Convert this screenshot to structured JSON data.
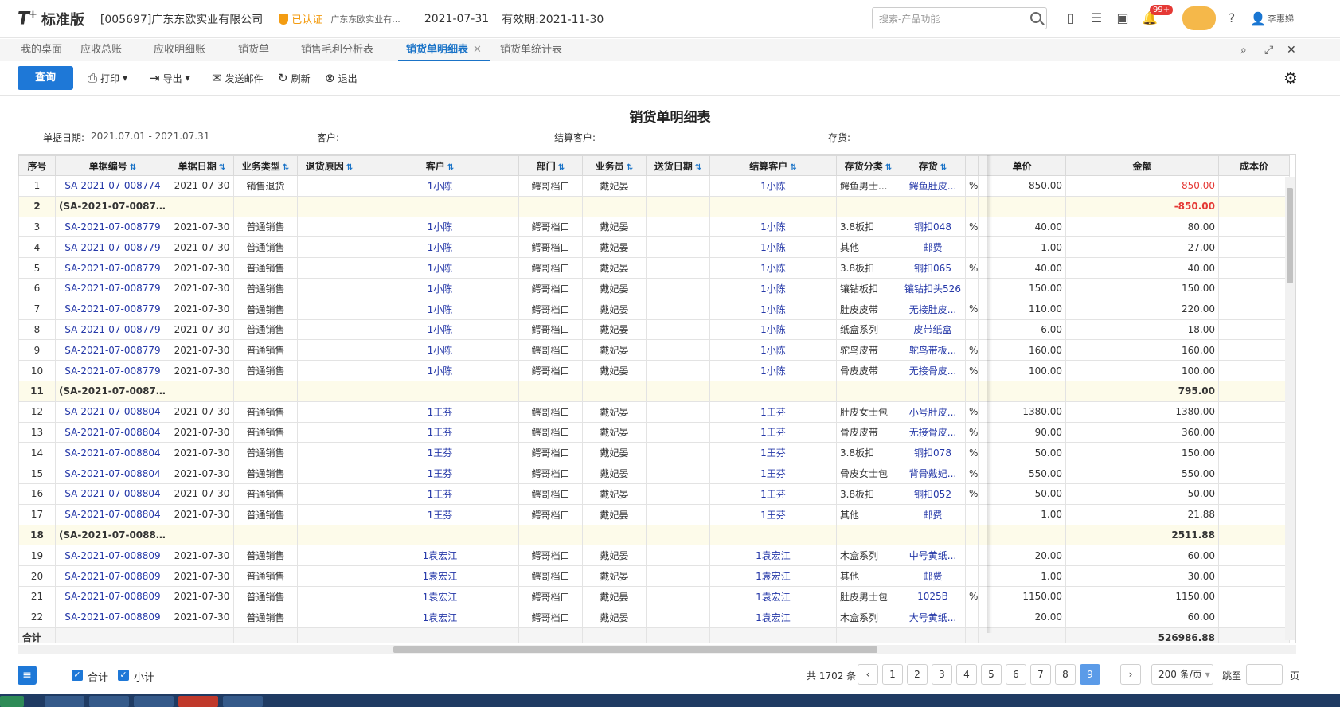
{
  "header": {
    "logo": "T",
    "logo_plus": "+",
    "edition": "标准版",
    "company": "[005697]广东东欧实业有限公司",
    "verified_label": "已认证",
    "verified_company": "广东东欧实业有...",
    "date": "2021-07-31",
    "valid_until": "有效期:2021-11-30",
    "search_placeholder": "搜索-产品功能",
    "badge": "99+",
    "user_name": "李惠娣"
  },
  "tabs": [
    {
      "label": "我的桌面"
    },
    {
      "label": "应收总账"
    },
    {
      "label": "应收明细账"
    },
    {
      "label": "销货单"
    },
    {
      "label": "销售毛利分析表"
    },
    {
      "label": "销货单明细表"
    },
    {
      "label": "销货单统计表"
    }
  ],
  "toolbar": {
    "query": "查询",
    "print": "打印",
    "export": "导出",
    "email": "发送邮件",
    "refresh": "刷新",
    "exit": "退出"
  },
  "report": {
    "title": "销货单明细表",
    "filter_date_label": "单据日期:",
    "filter_date_value": "2021.07.01 - 2021.07.31",
    "filter_customer_label": "客户:",
    "filter_settle_label": "结算客户:",
    "filter_stock_label": "存货:"
  },
  "columns": [
    "序号",
    "单据编号",
    "单据日期",
    "业务类型",
    "退货原因",
    "客户",
    "部门",
    "业务员",
    "送货日期",
    "结算客户",
    "存货分类",
    "存货",
    "",
    "单价",
    "金额",
    "成本价"
  ],
  "rows": [
    {
      "no": "1",
      "code": "SA-2021-07-008774",
      "date": "2021-07-30",
      "type": "销售退货",
      "reason": "",
      "customer": "1小陈",
      "dept": "鳄哥档口",
      "staff": "戴妃晏",
      "ship": "",
      "settle": "1小陈",
      "cat": "鳄鱼男士...",
      "stock": "鳄鱼肚皮...",
      "pct": "%",
      "price": "850.00",
      "amount": "-850.00",
      "cost": "",
      "neg": true
    },
    {
      "no": "2",
      "code": "(SA-2021-07-008774)...",
      "date": "",
      "type": "",
      "reason": "",
      "customer": "",
      "dept": "",
      "staff": "",
      "ship": "",
      "settle": "",
      "cat": "",
      "stock": "",
      "pct": "",
      "price": "",
      "amount": "-850.00",
      "cost": "",
      "sub": true,
      "neg": true
    },
    {
      "no": "3",
      "code": "SA-2021-07-008779",
      "date": "2021-07-30",
      "type": "普通销售",
      "reason": "",
      "customer": "1小陈",
      "dept": "鳄哥档口",
      "staff": "戴妃晏",
      "ship": "",
      "settle": "1小陈",
      "cat": "3.8板扣",
      "stock": "铜扣048",
      "pct": "%",
      "price": "40.00",
      "amount": "80.00",
      "cost": ""
    },
    {
      "no": "4",
      "code": "SA-2021-07-008779",
      "date": "2021-07-30",
      "type": "普通销售",
      "reason": "",
      "customer": "1小陈",
      "dept": "鳄哥档口",
      "staff": "戴妃晏",
      "ship": "",
      "settle": "1小陈",
      "cat": "其他",
      "stock": "邮费",
      "pct": "",
      "price": "1.00",
      "amount": "27.00",
      "cost": ""
    },
    {
      "no": "5",
      "code": "SA-2021-07-008779",
      "date": "2021-07-30",
      "type": "普通销售",
      "reason": "",
      "customer": "1小陈",
      "dept": "鳄哥档口",
      "staff": "戴妃晏",
      "ship": "",
      "settle": "1小陈",
      "cat": "3.8板扣",
      "stock": "铜扣065",
      "pct": "%",
      "price": "40.00",
      "amount": "40.00",
      "cost": ""
    },
    {
      "no": "6",
      "code": "SA-2021-07-008779",
      "date": "2021-07-30",
      "type": "普通销售",
      "reason": "",
      "customer": "1小陈",
      "dept": "鳄哥档口",
      "staff": "戴妃晏",
      "ship": "",
      "settle": "1小陈",
      "cat": "镶钻板扣",
      "stock": "镶钻扣头526",
      "pct": "",
      "price": "150.00",
      "amount": "150.00",
      "cost": ""
    },
    {
      "no": "7",
      "code": "SA-2021-07-008779",
      "date": "2021-07-30",
      "type": "普通销售",
      "reason": "",
      "customer": "1小陈",
      "dept": "鳄哥档口",
      "staff": "戴妃晏",
      "ship": "",
      "settle": "1小陈",
      "cat": "肚皮皮带",
      "stock": "无接肚皮...",
      "pct": "%",
      "price": "110.00",
      "amount": "220.00",
      "cost": ""
    },
    {
      "no": "8",
      "code": "SA-2021-07-008779",
      "date": "2021-07-30",
      "type": "普通销售",
      "reason": "",
      "customer": "1小陈",
      "dept": "鳄哥档口",
      "staff": "戴妃晏",
      "ship": "",
      "settle": "1小陈",
      "cat": "纸盒系列",
      "stock": "皮带纸盒",
      "pct": "",
      "price": "6.00",
      "amount": "18.00",
      "cost": ""
    },
    {
      "no": "9",
      "code": "SA-2021-07-008779",
      "date": "2021-07-30",
      "type": "普通销售",
      "reason": "",
      "customer": "1小陈",
      "dept": "鳄哥档口",
      "staff": "戴妃晏",
      "ship": "",
      "settle": "1小陈",
      "cat": "驼鸟皮带",
      "stock": "鸵鸟带板...",
      "pct": "%",
      "price": "160.00",
      "amount": "160.00",
      "cost": ""
    },
    {
      "no": "10",
      "code": "SA-2021-07-008779",
      "date": "2021-07-30",
      "type": "普通销售",
      "reason": "",
      "customer": "1小陈",
      "dept": "鳄哥档口",
      "staff": "戴妃晏",
      "ship": "",
      "settle": "1小陈",
      "cat": "骨皮皮带",
      "stock": "无接骨皮...",
      "pct": "%",
      "price": "100.00",
      "amount": "100.00",
      "cost": ""
    },
    {
      "no": "11",
      "code": "(SA-2021-07-008779)...",
      "date": "",
      "type": "",
      "reason": "",
      "customer": "",
      "dept": "",
      "staff": "",
      "ship": "",
      "settle": "",
      "cat": "",
      "stock": "",
      "pct": "",
      "price": "",
      "amount": "795.00",
      "cost": "",
      "sub": true
    },
    {
      "no": "12",
      "code": "SA-2021-07-008804",
      "date": "2021-07-30",
      "type": "普通销售",
      "reason": "",
      "customer": "1王芬",
      "dept": "鳄哥档口",
      "staff": "戴妃晏",
      "ship": "",
      "settle": "1王芬",
      "cat": "肚皮女士包",
      "stock": "小号肚皮...",
      "pct": "%",
      "price": "1380.00",
      "amount": "1380.00",
      "cost": ""
    },
    {
      "no": "13",
      "code": "SA-2021-07-008804",
      "date": "2021-07-30",
      "type": "普通销售",
      "reason": "",
      "customer": "1王芬",
      "dept": "鳄哥档口",
      "staff": "戴妃晏",
      "ship": "",
      "settle": "1王芬",
      "cat": "骨皮皮带",
      "stock": "无接骨皮...",
      "pct": "%",
      "price": "90.00",
      "amount": "360.00",
      "cost": ""
    },
    {
      "no": "14",
      "code": "SA-2021-07-008804",
      "date": "2021-07-30",
      "type": "普通销售",
      "reason": "",
      "customer": "1王芬",
      "dept": "鳄哥档口",
      "staff": "戴妃晏",
      "ship": "",
      "settle": "1王芬",
      "cat": "3.8板扣",
      "stock": "铜扣078",
      "pct": "%",
      "price": "50.00",
      "amount": "150.00",
      "cost": ""
    },
    {
      "no": "15",
      "code": "SA-2021-07-008804",
      "date": "2021-07-30",
      "type": "普通销售",
      "reason": "",
      "customer": "1王芬",
      "dept": "鳄哥档口",
      "staff": "戴妃晏",
      "ship": "",
      "settle": "1王芬",
      "cat": "骨皮女士包",
      "stock": "背骨戴妃...",
      "pct": "%",
      "price": "550.00",
      "amount": "550.00",
      "cost": ""
    },
    {
      "no": "16",
      "code": "SA-2021-07-008804",
      "date": "2021-07-30",
      "type": "普通销售",
      "reason": "",
      "customer": "1王芬",
      "dept": "鳄哥档口",
      "staff": "戴妃晏",
      "ship": "",
      "settle": "1王芬",
      "cat": "3.8板扣",
      "stock": "铜扣052",
      "pct": "%",
      "price": "50.00",
      "amount": "50.00",
      "cost": ""
    },
    {
      "no": "17",
      "code": "SA-2021-07-008804",
      "date": "2021-07-30",
      "type": "普通销售",
      "reason": "",
      "customer": "1王芬",
      "dept": "鳄哥档口",
      "staff": "戴妃晏",
      "ship": "",
      "settle": "1王芬",
      "cat": "其他",
      "stock": "邮费",
      "pct": "",
      "price": "1.00",
      "amount": "21.88",
      "cost": ""
    },
    {
      "no": "18",
      "code": "(SA-2021-07-008804)...",
      "date": "",
      "type": "",
      "reason": "",
      "customer": "",
      "dept": "",
      "staff": "",
      "ship": "",
      "settle": "",
      "cat": "",
      "stock": "",
      "pct": "",
      "price": "",
      "amount": "2511.88",
      "cost": "",
      "sub": true
    },
    {
      "no": "19",
      "code": "SA-2021-07-008809",
      "date": "2021-07-30",
      "type": "普通销售",
      "reason": "",
      "customer": "1袁宏江",
      "dept": "鳄哥档口",
      "staff": "戴妃晏",
      "ship": "",
      "settle": "1袁宏江",
      "cat": "木盒系列",
      "stock": "中号黄纸...",
      "pct": "",
      "price": "20.00",
      "amount": "60.00",
      "cost": ""
    },
    {
      "no": "20",
      "code": "SA-2021-07-008809",
      "date": "2021-07-30",
      "type": "普通销售",
      "reason": "",
      "customer": "1袁宏江",
      "dept": "鳄哥档口",
      "staff": "戴妃晏",
      "ship": "",
      "settle": "1袁宏江",
      "cat": "其他",
      "stock": "邮费",
      "pct": "",
      "price": "1.00",
      "amount": "30.00",
      "cost": ""
    },
    {
      "no": "21",
      "code": "SA-2021-07-008809",
      "date": "2021-07-30",
      "type": "普通销售",
      "reason": "",
      "customer": "1袁宏江",
      "dept": "鳄哥档口",
      "staff": "戴妃晏",
      "ship": "",
      "settle": "1袁宏江",
      "cat": "肚皮男士包",
      "stock": "1025B",
      "pct": "%",
      "price": "1150.00",
      "amount": "1150.00",
      "cost": ""
    },
    {
      "no": "22",
      "code": "SA-2021-07-008809",
      "date": "2021-07-30",
      "type": "普通销售",
      "reason": "",
      "customer": "1袁宏江",
      "dept": "鳄哥档口",
      "staff": "戴妃晏",
      "ship": "",
      "settle": "1袁宏江",
      "cat": "木盒系列",
      "stock": "大号黄纸...",
      "pct": "",
      "price": "20.00",
      "amount": "60.00",
      "cost": ""
    }
  ],
  "total": {
    "label": "合计",
    "amount": "526986.88"
  },
  "footer": {
    "chk_total": "合计",
    "chk_subtotal": "小计",
    "records": "共 1702 条",
    "pages": [
      "1",
      "2",
      "3",
      "4",
      "5",
      "6",
      "7",
      "8",
      "9"
    ],
    "current_page": "9",
    "prev": "‹",
    "next": "›",
    "page_size": "200 条/页",
    "jump_label": "跳至",
    "page_suffix": "页"
  }
}
